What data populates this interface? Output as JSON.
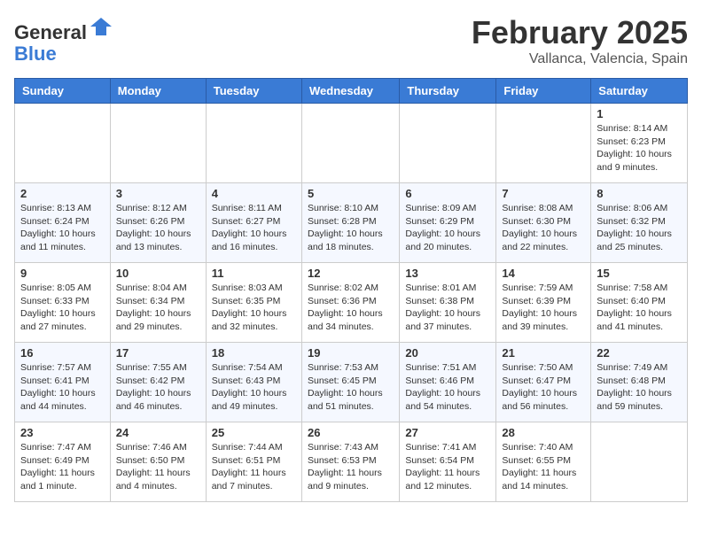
{
  "header": {
    "logo_general": "General",
    "logo_blue": "Blue",
    "month_title": "February 2025",
    "location": "Vallanca, Valencia, Spain"
  },
  "days_of_week": [
    "Sunday",
    "Monday",
    "Tuesday",
    "Wednesday",
    "Thursday",
    "Friday",
    "Saturday"
  ],
  "weeks": [
    [
      {
        "day": "",
        "info": ""
      },
      {
        "day": "",
        "info": ""
      },
      {
        "day": "",
        "info": ""
      },
      {
        "day": "",
        "info": ""
      },
      {
        "day": "",
        "info": ""
      },
      {
        "day": "",
        "info": ""
      },
      {
        "day": "1",
        "info": "Sunrise: 8:14 AM\nSunset: 6:23 PM\nDaylight: 10 hours\nand 9 minutes."
      }
    ],
    [
      {
        "day": "2",
        "info": "Sunrise: 8:13 AM\nSunset: 6:24 PM\nDaylight: 10 hours\nand 11 minutes."
      },
      {
        "day": "3",
        "info": "Sunrise: 8:12 AM\nSunset: 6:26 PM\nDaylight: 10 hours\nand 13 minutes."
      },
      {
        "day": "4",
        "info": "Sunrise: 8:11 AM\nSunset: 6:27 PM\nDaylight: 10 hours\nand 16 minutes."
      },
      {
        "day": "5",
        "info": "Sunrise: 8:10 AM\nSunset: 6:28 PM\nDaylight: 10 hours\nand 18 minutes."
      },
      {
        "day": "6",
        "info": "Sunrise: 8:09 AM\nSunset: 6:29 PM\nDaylight: 10 hours\nand 20 minutes."
      },
      {
        "day": "7",
        "info": "Sunrise: 8:08 AM\nSunset: 6:30 PM\nDaylight: 10 hours\nand 22 minutes."
      },
      {
        "day": "8",
        "info": "Sunrise: 8:06 AM\nSunset: 6:32 PM\nDaylight: 10 hours\nand 25 minutes."
      }
    ],
    [
      {
        "day": "9",
        "info": "Sunrise: 8:05 AM\nSunset: 6:33 PM\nDaylight: 10 hours\nand 27 minutes."
      },
      {
        "day": "10",
        "info": "Sunrise: 8:04 AM\nSunset: 6:34 PM\nDaylight: 10 hours\nand 29 minutes."
      },
      {
        "day": "11",
        "info": "Sunrise: 8:03 AM\nSunset: 6:35 PM\nDaylight: 10 hours\nand 32 minutes."
      },
      {
        "day": "12",
        "info": "Sunrise: 8:02 AM\nSunset: 6:36 PM\nDaylight: 10 hours\nand 34 minutes."
      },
      {
        "day": "13",
        "info": "Sunrise: 8:01 AM\nSunset: 6:38 PM\nDaylight: 10 hours\nand 37 minutes."
      },
      {
        "day": "14",
        "info": "Sunrise: 7:59 AM\nSunset: 6:39 PM\nDaylight: 10 hours\nand 39 minutes."
      },
      {
        "day": "15",
        "info": "Sunrise: 7:58 AM\nSunset: 6:40 PM\nDaylight: 10 hours\nand 41 minutes."
      }
    ],
    [
      {
        "day": "16",
        "info": "Sunrise: 7:57 AM\nSunset: 6:41 PM\nDaylight: 10 hours\nand 44 minutes."
      },
      {
        "day": "17",
        "info": "Sunrise: 7:55 AM\nSunset: 6:42 PM\nDaylight: 10 hours\nand 46 minutes."
      },
      {
        "day": "18",
        "info": "Sunrise: 7:54 AM\nSunset: 6:43 PM\nDaylight: 10 hours\nand 49 minutes."
      },
      {
        "day": "19",
        "info": "Sunrise: 7:53 AM\nSunset: 6:45 PM\nDaylight: 10 hours\nand 51 minutes."
      },
      {
        "day": "20",
        "info": "Sunrise: 7:51 AM\nSunset: 6:46 PM\nDaylight: 10 hours\nand 54 minutes."
      },
      {
        "day": "21",
        "info": "Sunrise: 7:50 AM\nSunset: 6:47 PM\nDaylight: 10 hours\nand 56 minutes."
      },
      {
        "day": "22",
        "info": "Sunrise: 7:49 AM\nSunset: 6:48 PM\nDaylight: 10 hours\nand 59 minutes."
      }
    ],
    [
      {
        "day": "23",
        "info": "Sunrise: 7:47 AM\nSunset: 6:49 PM\nDaylight: 11 hours\nand 1 minute."
      },
      {
        "day": "24",
        "info": "Sunrise: 7:46 AM\nSunset: 6:50 PM\nDaylight: 11 hours\nand 4 minutes."
      },
      {
        "day": "25",
        "info": "Sunrise: 7:44 AM\nSunset: 6:51 PM\nDaylight: 11 hours\nand 7 minutes."
      },
      {
        "day": "26",
        "info": "Sunrise: 7:43 AM\nSunset: 6:53 PM\nDaylight: 11 hours\nand 9 minutes."
      },
      {
        "day": "27",
        "info": "Sunrise: 7:41 AM\nSunset: 6:54 PM\nDaylight: 11 hours\nand 12 minutes."
      },
      {
        "day": "28",
        "info": "Sunrise: 7:40 AM\nSunset: 6:55 PM\nDaylight: 11 hours\nand 14 minutes."
      },
      {
        "day": "",
        "info": ""
      }
    ]
  ]
}
